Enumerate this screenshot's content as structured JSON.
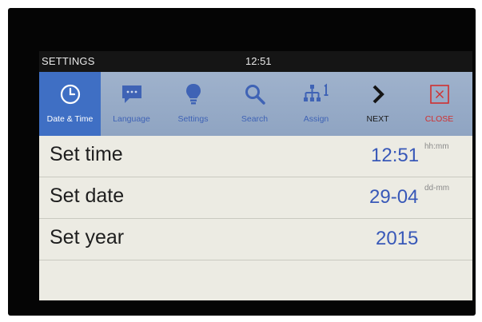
{
  "status": {
    "title": "SETTINGS",
    "clock": "12:51"
  },
  "toolbar": {
    "items": [
      {
        "label": "Date & Time",
        "icon": "clock-icon",
        "active": true
      },
      {
        "label": "Language",
        "icon": "speech-bubble-icon",
        "active": false
      },
      {
        "label": "Settings",
        "icon": "lightbulb-icon",
        "active": false
      },
      {
        "label": "Search",
        "icon": "search-icon",
        "active": false
      },
      {
        "label": "Assign",
        "icon": "network-icon",
        "active": false
      },
      {
        "label": "NEXT",
        "icon": "chevron-right-icon",
        "active": false
      },
      {
        "label": "CLOSE",
        "icon": "close-icon",
        "active": false
      }
    ]
  },
  "rows": [
    {
      "label": "Set time",
      "value": "12:51",
      "unit": "hh:mm"
    },
    {
      "label": "Set date",
      "value": "29-04",
      "unit": "dd-mm"
    },
    {
      "label": "Set year",
      "value": "2015",
      "unit": ""
    }
  ],
  "colors": {
    "accent": "#3f6fc4",
    "toolbar": "#9fb2cc",
    "value_text": "#3858b8",
    "close": "#d03030"
  }
}
